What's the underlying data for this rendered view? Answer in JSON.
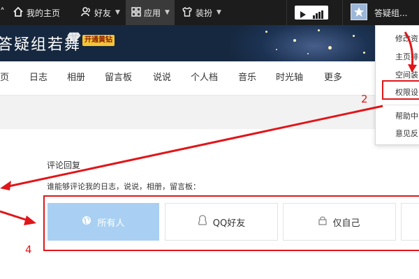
{
  "topbar": {
    "left_cut_char": "A˄",
    "items": [
      {
        "label": "我的主页",
        "icon": "home-icon",
        "dropdown": false
      },
      {
        "label": "好友",
        "icon": "friends-icon",
        "dropdown": true
      },
      {
        "label": "应用",
        "icon": "apps-grid-icon",
        "dropdown": true
      },
      {
        "label": "装扮",
        "icon": "tshirt-icon",
        "dropdown": true
      }
    ],
    "username": "答疑组..."
  },
  "banner": {
    "title": "答疑组若舞",
    "vip_label": "开通黄钻"
  },
  "nav": {
    "items": [
      "页",
      "日志",
      "相册",
      "留言板",
      "说说",
      "个人档",
      "音乐",
      "时光轴",
      "更多"
    ]
  },
  "dropdown": {
    "items": [
      "修改资",
      "主页排",
      "空间装",
      "权限设",
      "帮助中",
      "意见反"
    ]
  },
  "content": {
    "section_title": "评论回复",
    "section_desc": "谁能够评论我的日志，说说，相册，留言板：",
    "options": [
      {
        "label": "所有人",
        "icon": "globe-icon",
        "selected": true
      },
      {
        "label": "QQ好友",
        "icon": "person-outline-icon",
        "selected": false
      },
      {
        "label": "仅自己",
        "icon": "lock-icon",
        "selected": false
      }
    ]
  },
  "annotations": {
    "step2": "2",
    "step4": "4",
    "color": "#e0161a"
  },
  "colors": {
    "topbar_bg": "#1c1c1c",
    "selected_option_bg": "#a9d0f2",
    "banner_bg": "#16283f"
  }
}
